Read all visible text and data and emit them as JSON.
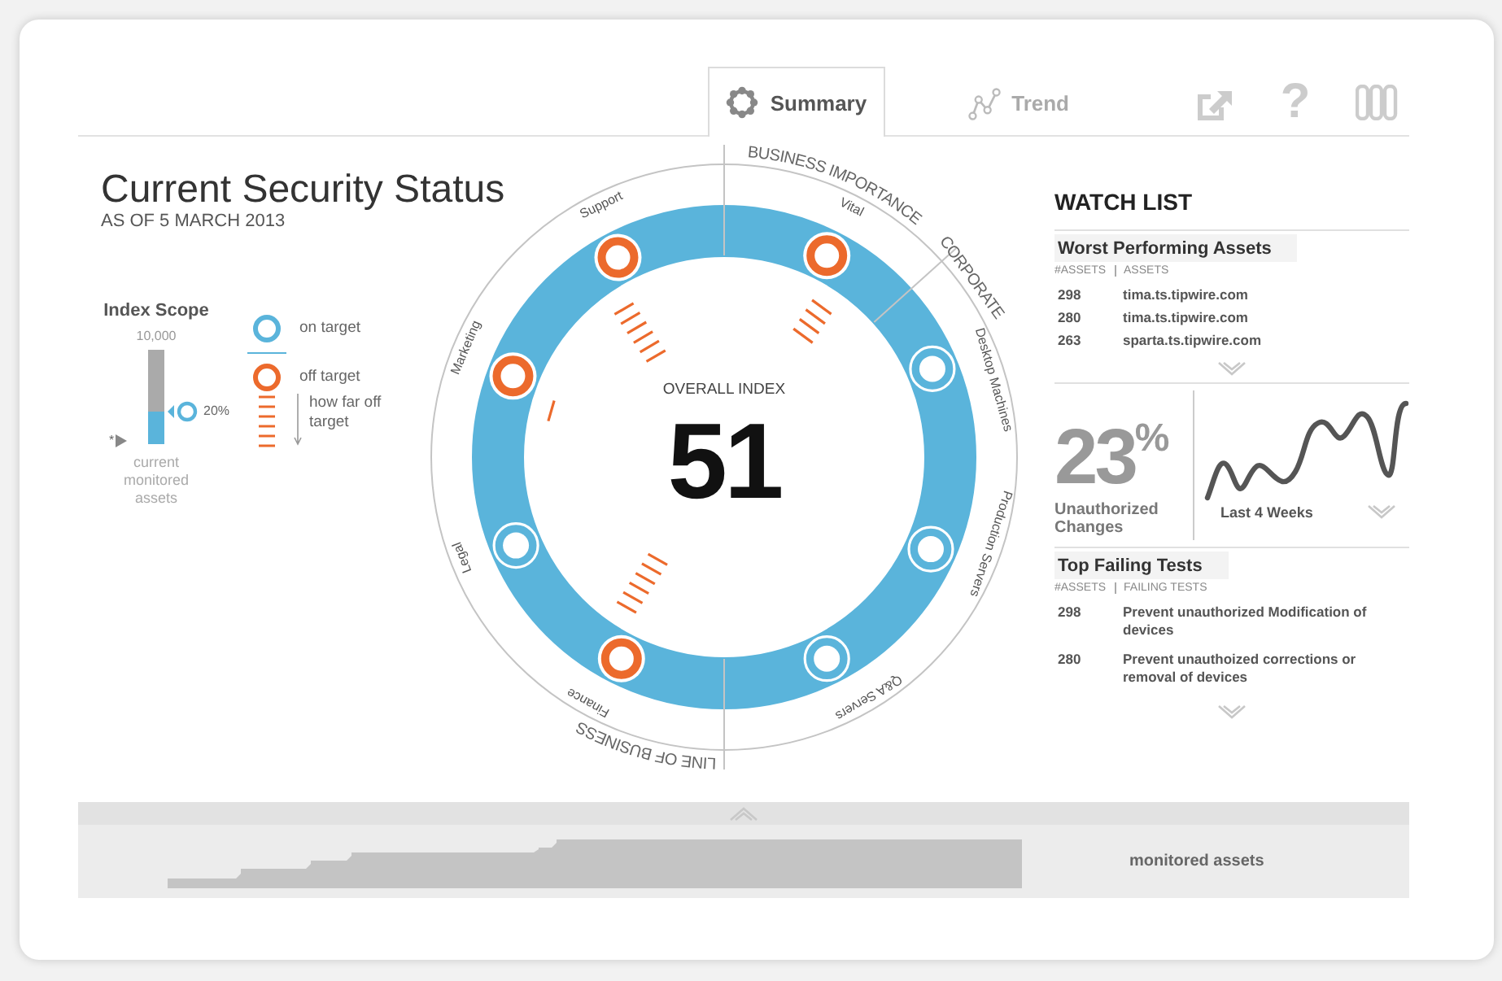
{
  "tabs": [
    {
      "label": "Summary",
      "kind": "summary",
      "selected": true
    },
    {
      "label": "Trend",
      "kind": "trend",
      "selected": false
    }
  ],
  "toolbar": [
    {
      "kind": "export"
    },
    {
      "kind": "help",
      "glyph": "?"
    },
    {
      "kind": "columns"
    }
  ],
  "title": "Current Security Status",
  "subtitle": "AS OF 5 MARCH 2013",
  "index_scope": {
    "title": "Index Scope",
    "max": "10,000",
    "level": 0.35,
    "marker": "20%",
    "note": "*",
    "caption": "current monitored assets"
  },
  "legend": [
    {
      "kind": "on_target",
      "label": "on target"
    },
    {
      "kind": "off_target",
      "label": "off target"
    },
    {
      "kind": "distance",
      "label": "how far off target"
    }
  ],
  "dial": {
    "caption": "OVERALL INDEX",
    "value": "51",
    "groups": [
      {
        "label": "BUSINESS IMPORTANCE",
        "kind": "top"
      },
      {
        "label": "CORPORATE",
        "kind": "right"
      },
      {
        "label": "LINE OF BUSINESS",
        "kind": "bottom"
      }
    ],
    "nodes": [
      {
        "label": "Support",
        "kind": "off_far"
      },
      {
        "label": "Vital",
        "kind": "off_mid"
      },
      {
        "label": "Marketing",
        "kind": "off_near"
      },
      {
        "label": "Desktop Machines",
        "kind": "on_target"
      },
      {
        "label": "Legal",
        "kind": "on_target"
      },
      {
        "label": "Production Servers",
        "kind": "on_target"
      },
      {
        "label": "Finance",
        "kind": "off_far"
      },
      {
        "label": "Q&A Servers",
        "kind": "on_target"
      }
    ]
  },
  "watch_list": {
    "title": "WATCH LIST",
    "worst_assets": {
      "title": "Worst Performing Assets",
      "columns": [
        "#ASSETS",
        "ASSETS"
      ],
      "rows": [
        {
          "count": "298",
          "name": "tima.ts.tipwire.com"
        },
        {
          "count": "280",
          "name": "tima.ts.tipwire.com"
        },
        {
          "count": "263",
          "name": "sparta.ts.tipwire.com"
        }
      ]
    },
    "changes": {
      "value": "23$^{%}$",
      "label": "Unauthorized Changes",
      "period": "Last 4 Weeks"
    },
    "failing_tests": {
      "title": "Top Failing Tests",
      "columns": [
        "#ASSETS",
        "FAILING TESTS"
      ],
      "rows": [
        {
          "count": "298",
          "name": "Prevent unauthorized Modification of devices"
        },
        {
          "count": "280",
          "name": "Prevent unauthoized corrections or removal of devices"
        }
      ]
    }
  },
  "footer": {
    "label": "monitored assets"
  }
}
